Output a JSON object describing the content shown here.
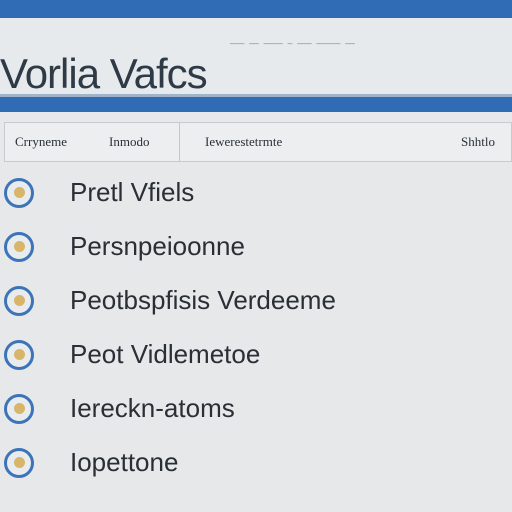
{
  "window": {
    "title": "Vorlia Vafcs",
    "title_noise": "——— —— ———— — ——— ————— ——"
  },
  "tabs": [
    {
      "label": "Crryneme"
    },
    {
      "label": "Inmodo"
    },
    {
      "label": "Iewerestetrmte"
    },
    {
      "label": "Shhtlo"
    }
  ],
  "list": [
    {
      "label": "Pretl Vfiels",
      "icon": "shield-icon"
    },
    {
      "label": "Persnpeioonne",
      "icon": "shield-icon"
    },
    {
      "label": "Peotbspfisis Verdeeme",
      "icon": "shield-icon"
    },
    {
      "label": "Peot Vidlemetoe",
      "icon": "shield-icon"
    },
    {
      "label": "Iereckn-atoms",
      "icon": "shield-icon"
    },
    {
      "label": "Iopettone",
      "icon": "shield-icon"
    }
  ]
}
